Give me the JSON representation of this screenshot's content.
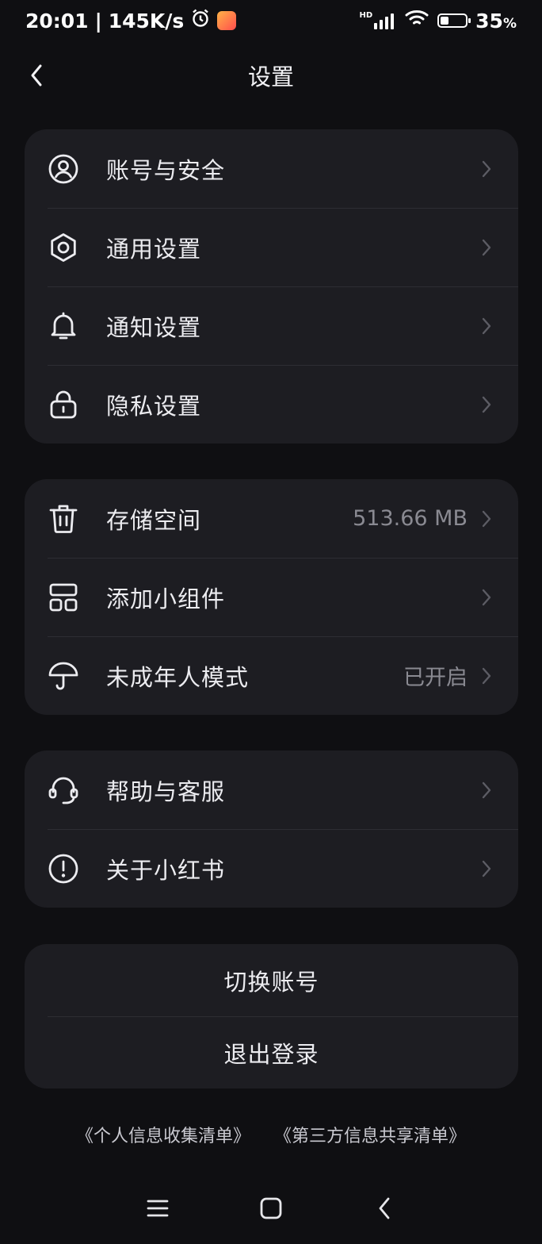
{
  "status_bar": {
    "time": "20:01",
    "separator": "|",
    "speed": "145K/s",
    "network": "HD",
    "battery_percent": "35",
    "battery_unit": "%",
    "battery_level": 0.35
  },
  "nav": {
    "title": "设置"
  },
  "groups": [
    {
      "items": [
        {
          "label": "账号与安全",
          "icon": "user-icon"
        },
        {
          "label": "通用设置",
          "icon": "gear-icon"
        },
        {
          "label": "通知设置",
          "icon": "bell-icon"
        },
        {
          "label": "隐私设置",
          "icon": "lock-icon"
        }
      ]
    },
    {
      "items": [
        {
          "label": "存储空间",
          "value": "513.66 MB",
          "icon": "trash-icon"
        },
        {
          "label": "添加小组件",
          "icon": "widget-icon"
        },
        {
          "label": "未成年人模式",
          "value": "已开启",
          "icon": "umbrella-icon"
        }
      ]
    },
    {
      "items": [
        {
          "label": "帮助与客服",
          "icon": "headset-icon"
        },
        {
          "label": "关于小红书",
          "icon": "info-icon"
        }
      ]
    }
  ],
  "actions": {
    "switch_account": "切换账号",
    "logout": "退出登录"
  },
  "footer": {
    "personal_info": "《个人信息收集清单》",
    "third_party": "《第三方信息共享清单》"
  },
  "colors": {
    "background": "#0f0f12",
    "card": "#1d1d22",
    "secondary_text": "#8a8a92"
  }
}
